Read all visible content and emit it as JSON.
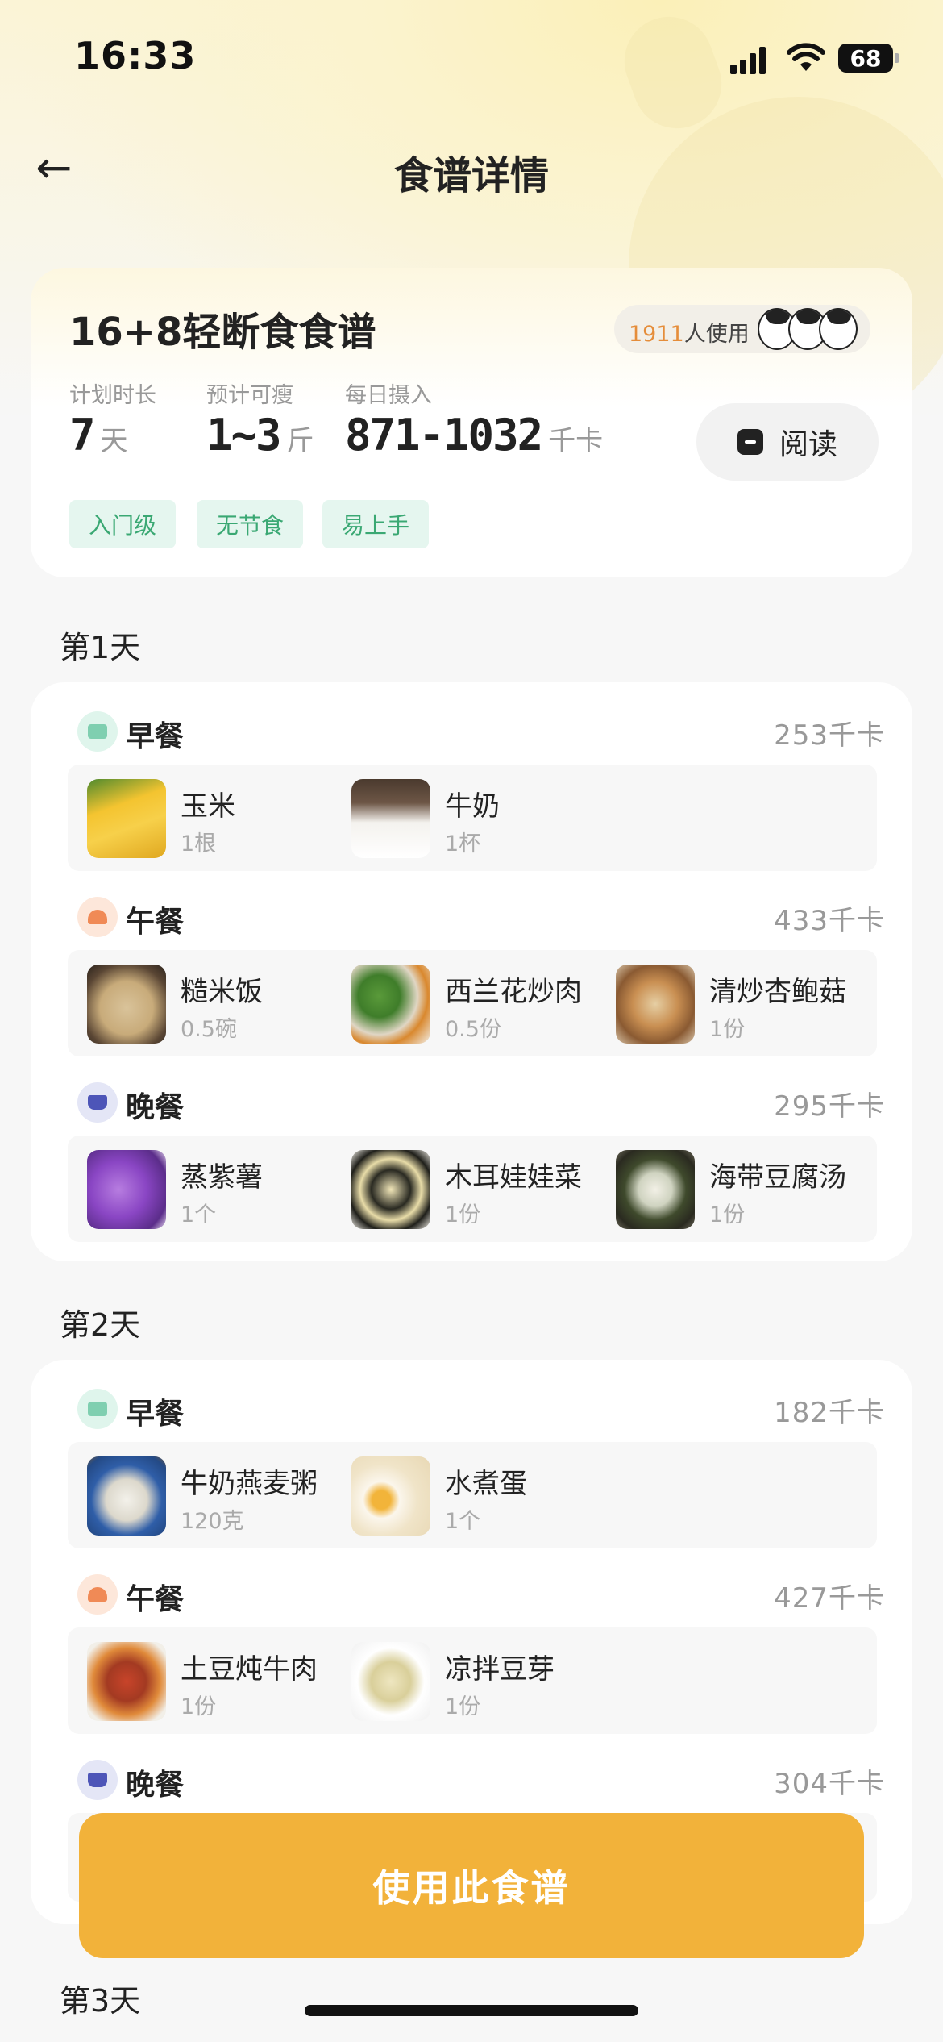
{
  "status_bar": {
    "time": "16:33",
    "battery": "68"
  },
  "nav": {
    "back_icon": "←",
    "title": "食谱详情"
  },
  "summary": {
    "title": "16+8轻断食食谱",
    "users_count": "1911",
    "users_suffix": "人使用",
    "stats": [
      {
        "label": "计划时长",
        "value": "7",
        "unit": "天"
      },
      {
        "label": "预计可瘦",
        "value": "1~3",
        "unit": "斤"
      },
      {
        "label": "每日摄入",
        "value": "871-1032",
        "unit": "千卡"
      }
    ],
    "read_label": "阅读",
    "tags": [
      "入门级",
      "无节食",
      "易上手"
    ]
  },
  "days": [
    {
      "title": "第1天",
      "meals": [
        {
          "name": "早餐",
          "kcal": "253千卡",
          "icon": "breakfast-icon",
          "foods": [
            {
              "name": "玉米",
              "qty": "1根"
            },
            {
              "name": "牛奶",
              "qty": "1杯"
            }
          ]
        },
        {
          "name": "午餐",
          "kcal": "433千卡",
          "icon": "lunch-icon",
          "foods": [
            {
              "name": "糙米饭",
              "qty": "0.5碗"
            },
            {
              "name": "西兰花炒肉",
              "qty": "0.5份"
            },
            {
              "name": "清炒杏鲍菇",
              "qty": "1份"
            }
          ]
        },
        {
          "name": "晚餐",
          "kcal": "295千卡",
          "icon": "dinner-icon",
          "foods": [
            {
              "name": "蒸紫薯",
              "qty": "1个"
            },
            {
              "name": "木耳娃娃菜",
              "qty": "1份"
            },
            {
              "name": "海带豆腐汤",
              "qty": "1份"
            }
          ]
        }
      ]
    },
    {
      "title": "第2天",
      "meals": [
        {
          "name": "早餐",
          "kcal": "182千卡",
          "icon": "breakfast-icon",
          "foods": [
            {
              "name": "牛奶燕麦粥",
              "qty": "120克"
            },
            {
              "name": "水煮蛋",
              "qty": "1个"
            }
          ]
        },
        {
          "name": "午餐",
          "kcal": "427千卡",
          "icon": "lunch-icon",
          "foods": [
            {
              "name": "土豆炖牛肉",
              "qty": "1份"
            },
            {
              "name": "凉拌豆芽",
              "qty": "1份"
            }
          ]
        },
        {
          "name": "晚餐",
          "kcal": "304千卡",
          "icon": "dinner-icon",
          "foods": []
        }
      ]
    },
    {
      "title": "第3天",
      "meals": []
    }
  ],
  "use_button": "使用此食谱"
}
